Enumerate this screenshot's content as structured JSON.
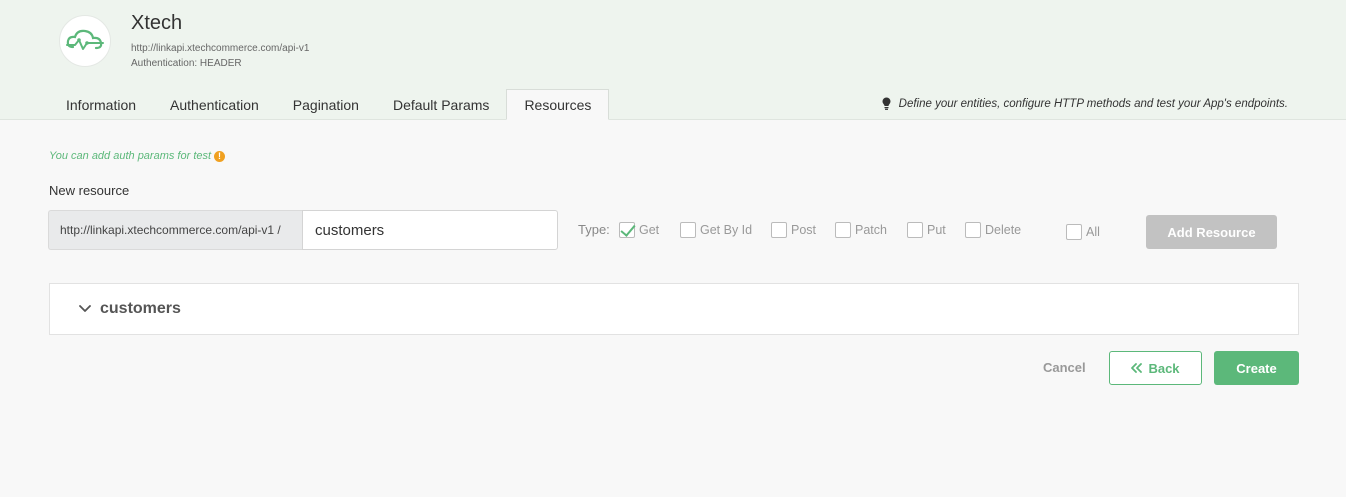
{
  "app": {
    "title": "Xtech",
    "url": "http://linkapi.xtechcommerce.com/api-v1",
    "auth": "Authentication: HEADER",
    "logo_icon": "cloud-link-icon"
  },
  "tabs": [
    {
      "label": "Information",
      "active": false
    },
    {
      "label": "Authentication",
      "active": false
    },
    {
      "label": "Pagination",
      "active": false
    },
    {
      "label": "Default Params",
      "active": false
    },
    {
      "label": "Resources",
      "active": true
    }
  ],
  "hint": {
    "icon": "lightbulb-icon",
    "text": "Define your entities, configure HTTP methods and test your App's endpoints."
  },
  "auth_note": {
    "text": "You can add auth params for test",
    "icon": "warning-icon"
  },
  "new_resource": {
    "label": "New resource",
    "url_prefix": "http://linkapi.xtechcommerce.com/api-v1 /",
    "input_value": "customers"
  },
  "type_label": "Type:",
  "methods": [
    {
      "label": "Get",
      "checked": true
    },
    {
      "label": "Get By Id",
      "checked": false
    },
    {
      "label": "Post",
      "checked": false
    },
    {
      "label": "Patch",
      "checked": false
    },
    {
      "label": "Put",
      "checked": false
    },
    {
      "label": "Delete",
      "checked": false
    },
    {
      "label": "All",
      "checked": false
    }
  ],
  "add_resource_label": "Add Resource",
  "panel": {
    "title": "customers"
  },
  "footer": {
    "cancel": "Cancel",
    "back": "Back",
    "create": "Create"
  },
  "colors": {
    "accent": "#5cb87a",
    "disabled": "#c2c2c2",
    "header_bg": "#eef4ee",
    "warning": "#f0a020"
  }
}
